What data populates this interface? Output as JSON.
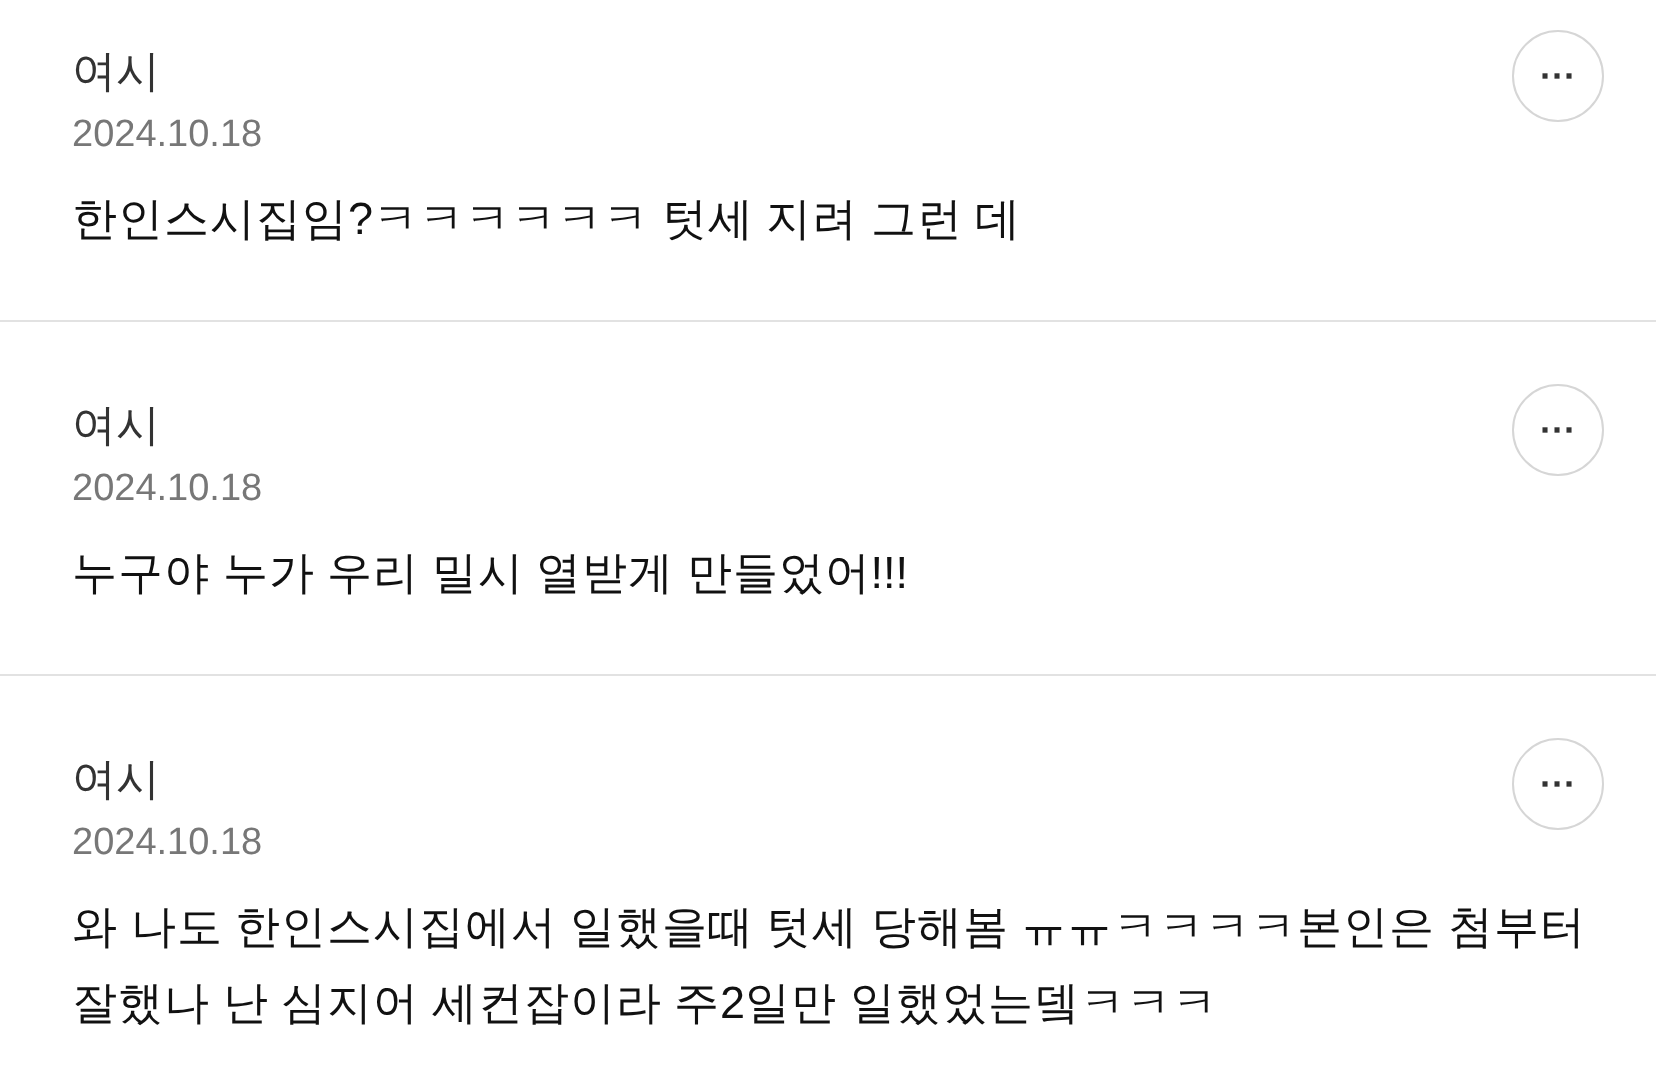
{
  "comments": [
    {
      "author": "여시",
      "date": "2024.10.18",
      "text": "한인스시집임?ㅋㅋㅋㅋㅋㅋ 텃세 지려 그런 데",
      "more": "···"
    },
    {
      "author": "여시",
      "date": "2024.10.18",
      "text": "누구야 누가 우리 밀시 열받게 만들었어!!!",
      "more": "···"
    },
    {
      "author": "여시",
      "date": "2024.10.18",
      "text": "와 나도 한인스시집에서 일했을때 텃세 당해봄 ㅠㅠㅋㅋㅋㅋ본인은 첨부터 잘했나 난 심지어 세컨잡이라 주2일만 일했었는뎈ㅋㅋㅋ",
      "more": "···"
    }
  ]
}
